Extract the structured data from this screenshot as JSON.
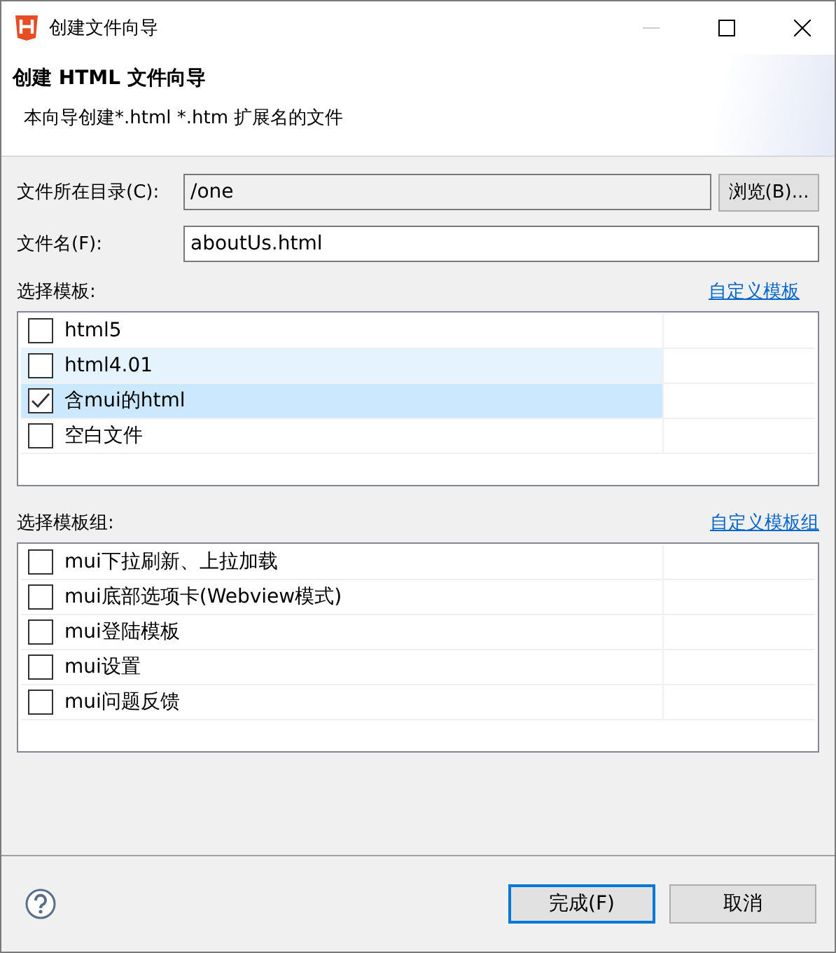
{
  "window": {
    "title": "创建文件向导"
  },
  "header": {
    "title": "创建 HTML 文件向导",
    "description": "本向导创建*.html *.htm 扩展名的文件"
  },
  "fields": [
    {
      "label": "文件所在目录(C):",
      "value": "/one",
      "readonly": true,
      "button": "浏览(B)..."
    },
    {
      "label": "文件名(F):",
      "value": "aboutUs.html",
      "readonly": false
    }
  ],
  "templates": {
    "label": "选择模板:",
    "link": "自定义模板",
    "items": [
      {
        "label": "html5",
        "checked": false,
        "selected": false,
        "hovered": false
      },
      {
        "label": "html4.01",
        "checked": false,
        "selected": false,
        "hovered": true
      },
      {
        "label": "含mui的html",
        "checked": true,
        "selected": true,
        "hovered": false
      },
      {
        "label": "空白文件",
        "checked": false,
        "selected": false,
        "hovered": false
      }
    ]
  },
  "template_groups": {
    "label": "选择模板组:",
    "link": "自定义模板组",
    "items": [
      {
        "label": "mui下拉刷新、上拉加载",
        "checked": false,
        "selected": false,
        "hovered": false
      },
      {
        "label": "mui底部选项卡(Webview模式)",
        "checked": false,
        "selected": false,
        "hovered": false
      },
      {
        "label": "mui登陆模板",
        "checked": false,
        "selected": false,
        "hovered": false
      },
      {
        "label": "mui设置",
        "checked": false,
        "selected": false,
        "hovered": false
      },
      {
        "label": "mui问题反馈",
        "checked": false,
        "selected": false,
        "hovered": false
      }
    ]
  },
  "buttons": [
    {
      "label": "完成(F)",
      "default": true
    },
    {
      "label": "取消",
      "default": false
    }
  ]
}
